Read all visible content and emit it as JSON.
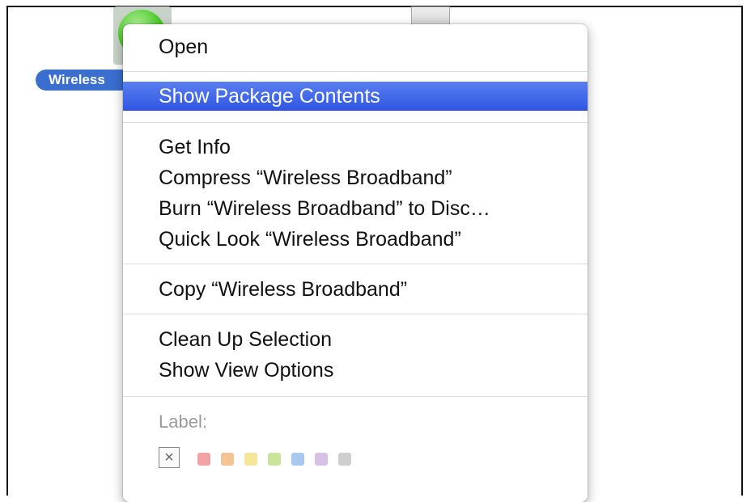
{
  "desktop": {
    "file_label": "Wireless",
    "selected_icon": "app-icon",
    "other_icon": "document-icon"
  },
  "menu": {
    "open": "Open",
    "show_package_contents": "Show Package Contents",
    "get_info": "Get Info",
    "compress": "Compress “Wireless Broadband”",
    "burn": "Burn “Wireless Broadband” to Disc…",
    "quick_look": "Quick Look “Wireless Broadband”",
    "copy": "Copy “Wireless Broadband”",
    "clean_up_selection": "Clean Up Selection",
    "show_view_options": "Show View Options",
    "label_heading": "Label:",
    "label_none_glyph": "×",
    "label_colors": [
      "#f2a3a6",
      "#f6c494",
      "#f3e59a",
      "#c9e59c",
      "#a9c8f0",
      "#d8c1e6",
      "#cfcfcf"
    ]
  },
  "colors": {
    "selection": "#3a62ea",
    "file_label_bg": "#3a6fd0"
  }
}
